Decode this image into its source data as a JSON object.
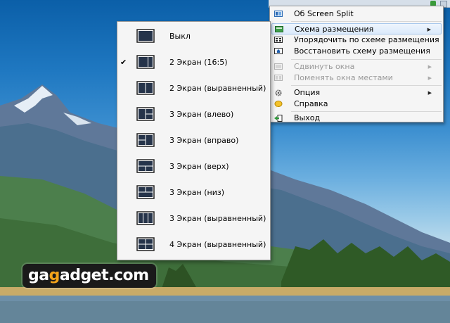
{
  "main_menu": {
    "items": [
      {
        "label": "Об Screen Split",
        "icon": "screen-split-app-icon",
        "disabled": false,
        "submenu": false
      },
      {
        "label": "Схема размещения",
        "icon": "layout-scheme-icon",
        "disabled": false,
        "submenu": true,
        "highlighted": true
      },
      {
        "label": "Упорядочить по схеме размещения",
        "icon": "arrange-windows-icon",
        "disabled": false,
        "submenu": false
      },
      {
        "label": "Восстановить схему размещения",
        "icon": "restore-layout-icon",
        "disabled": false,
        "submenu": false
      },
      {
        "label": "Сдвинуть окна",
        "icon": "move-windows-icon",
        "disabled": true,
        "submenu": true
      },
      {
        "label": "Поменять окна местами",
        "icon": "swap-windows-icon",
        "disabled": true,
        "submenu": true
      },
      {
        "label": "Опция",
        "icon": "options-gear-icon",
        "disabled": false,
        "submenu": true
      },
      {
        "label": "Справка",
        "icon": "help-icon",
        "disabled": false,
        "submenu": false
      },
      {
        "label": "Выход",
        "icon": "exit-icon",
        "disabled": false,
        "submenu": false
      }
    ]
  },
  "sub_menu": {
    "items": [
      {
        "label": "Выкл",
        "layout": "single",
        "checked": false
      },
      {
        "label": "2 Экран (16:5)",
        "layout": "two-wide-left",
        "checked": true
      },
      {
        "label": "2 Экран (выравненный)",
        "layout": "two-equal",
        "checked": false
      },
      {
        "label": "3 Экран (влево)",
        "layout": "three-left",
        "checked": false
      },
      {
        "label": "3 Экран (вправо)",
        "layout": "three-right",
        "checked": false
      },
      {
        "label": "3 Экран (верх)",
        "layout": "three-top",
        "checked": false
      },
      {
        "label": "3 Экран (низ)",
        "layout": "three-bottom",
        "checked": false
      },
      {
        "label": "3 Экран (выравненный)",
        "layout": "three-equal",
        "checked": false
      },
      {
        "label": "4 Экран (выравненный)",
        "layout": "four-equal",
        "checked": false
      }
    ],
    "check_glyph": "✔"
  },
  "watermark": {
    "prefix": "ga",
    "accent": "g",
    "suffix": "adget.com"
  },
  "colors": {
    "menu_bg": "#f5f5f5",
    "highlight": "#dbeafb",
    "disabled_text": "#9a9a9a",
    "logo_accent": "#f2a31a"
  }
}
